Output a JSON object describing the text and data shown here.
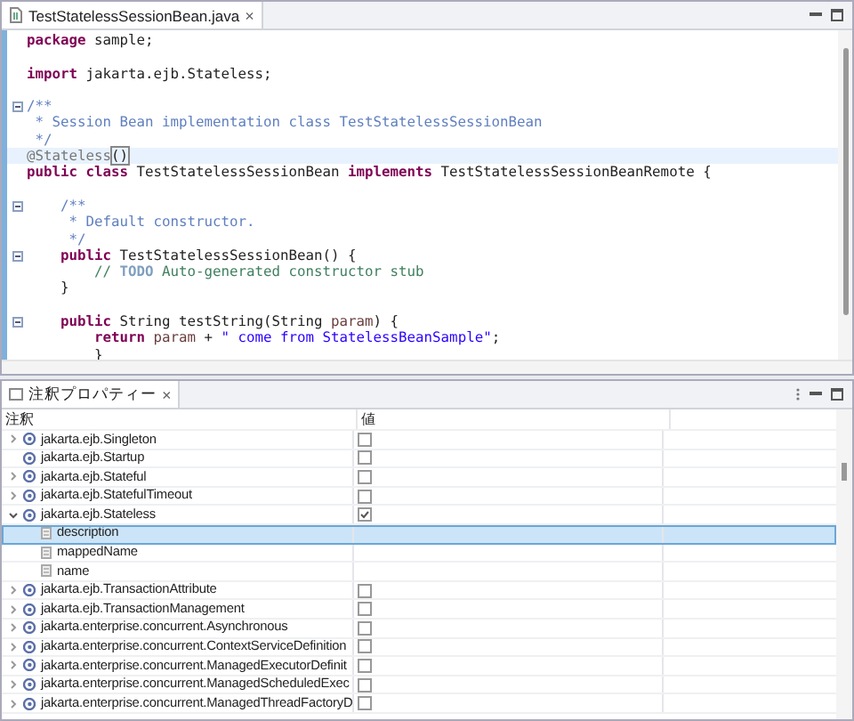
{
  "editor": {
    "tab": {
      "title": "TestStatelessSessionBean.java",
      "close": "×",
      "selected": true
    },
    "lines": [
      {
        "fold": false,
        "current": false,
        "tokens": [
          {
            "kind": "keyword",
            "text": "package"
          },
          {
            "kind": "plain",
            "text": " sample;"
          }
        ]
      },
      {
        "fold": false,
        "current": false
      },
      {
        "fold": false,
        "current": false,
        "tokens": [
          {
            "kind": "keyword",
            "text": "import"
          },
          {
            "kind": "plain",
            "text": " jakarta.ejb.Stateless;"
          }
        ]
      },
      {
        "fold": false,
        "current": false
      },
      {
        "fold": true,
        "current": false,
        "tokens": [
          {
            "kind": "javadoc",
            "text": "/**"
          }
        ]
      },
      {
        "fold": false,
        "current": false,
        "tokens": [
          {
            "kind": "javadoc",
            "text": " * Session Bean implementation class TestStatelessSessionBean"
          }
        ]
      },
      {
        "fold": false,
        "current": false,
        "tokens": [
          {
            "kind": "javadoc",
            "text": " */"
          }
        ]
      },
      {
        "fold": false,
        "current": true,
        "tokens": [
          {
            "kind": "annotation",
            "text": "@Stateless"
          },
          {
            "kind": "bracket",
            "text": "()"
          }
        ]
      },
      {
        "fold": false,
        "current": false,
        "tokens": [
          {
            "kind": "keyword",
            "text": "public class"
          },
          {
            "kind": "plain",
            "text": " TestStatelessSessionBean "
          },
          {
            "kind": "keyword",
            "text": "implements"
          },
          {
            "kind": "plain",
            "text": " TestStatelessSessionBeanRemote {"
          }
        ]
      },
      {
        "fold": false,
        "current": false
      },
      {
        "fold": true,
        "current": false,
        "tokens": [
          {
            "kind": "javadoc",
            "text": "    /**"
          }
        ]
      },
      {
        "fold": false,
        "current": false,
        "tokens": [
          {
            "kind": "javadoc",
            "text": "     * Default constructor."
          }
        ]
      },
      {
        "fold": false,
        "current": false,
        "tokens": [
          {
            "kind": "javadoc",
            "text": "     */"
          }
        ]
      },
      {
        "fold": true,
        "current": false,
        "tokens": [
          {
            "kind": "keyword",
            "text": "    public"
          },
          {
            "kind": "plain",
            "text": " TestStatelessSessionBean() {"
          }
        ]
      },
      {
        "fold": false,
        "current": false,
        "tokens": [
          {
            "kind": "comment",
            "text": "        // "
          },
          {
            "kind": "todo",
            "text": "TODO"
          },
          {
            "kind": "comment",
            "text": " Auto-generated constructor stub"
          }
        ]
      },
      {
        "fold": false,
        "current": false,
        "tokens": [
          {
            "kind": "plain",
            "text": "    }"
          }
        ]
      },
      {
        "fold": false,
        "current": false
      },
      {
        "fold": true,
        "current": false,
        "tokens": [
          {
            "kind": "keyword",
            "text": "    public"
          },
          {
            "kind": "plain",
            "text": " String testString(String "
          },
          {
            "kind": "param",
            "text": "param"
          },
          {
            "kind": "plain",
            "text": ") {"
          }
        ]
      },
      {
        "fold": false,
        "current": false,
        "tokens": [
          {
            "kind": "keyword",
            "text": "        return"
          },
          {
            "kind": "param",
            "text": " param"
          },
          {
            "kind": "plain",
            "text": " + "
          },
          {
            "kind": "string",
            "text": "\" come from StatelessBeanSample\""
          },
          {
            "kind": "plain",
            "text": ";"
          }
        ]
      },
      {
        "fold": false,
        "current": false,
        "tokens": [
          {
            "kind": "plain",
            "text": "        }"
          }
        ]
      }
    ]
  },
  "view": {
    "tab": {
      "title": "注釈プロパティー",
      "close": "×",
      "selected": true
    },
    "columns": [
      "注釈",
      "値"
    ],
    "rows": [
      {
        "kind": "annotation",
        "name": "jakarta.ejb.Singleton",
        "expandable": true,
        "expanded": false,
        "checked": false,
        "selected": false
      },
      {
        "kind": "annotation",
        "name": "jakarta.ejb.Startup",
        "expandable": false,
        "checked": false,
        "selected": false
      },
      {
        "kind": "annotation",
        "name": "jakarta.ejb.Stateful",
        "expandable": true,
        "expanded": false,
        "checked": false,
        "selected": false
      },
      {
        "kind": "annotation",
        "name": "jakarta.ejb.StatefulTimeout",
        "expandable": true,
        "expanded": false,
        "checked": false,
        "selected": false
      },
      {
        "kind": "annotation",
        "name": "jakarta.ejb.Stateless",
        "expandable": true,
        "expanded": true,
        "checked": true,
        "selected": false,
        "children": [
          {
            "kind": "member",
            "name": "description",
            "selected": true
          },
          {
            "kind": "member",
            "name": "mappedName",
            "selected": false
          },
          {
            "kind": "member",
            "name": "name",
            "selected": false
          }
        ]
      },
      {
        "kind": "annotation",
        "name": "jakarta.ejb.TransactionAttribute",
        "expandable": true,
        "expanded": false,
        "checked": false,
        "selected": false
      },
      {
        "kind": "annotation",
        "name": "jakarta.ejb.TransactionManagement",
        "expandable": true,
        "expanded": false,
        "checked": false,
        "selected": false
      },
      {
        "kind": "annotation",
        "name": "jakarta.enterprise.concurrent.Asynchronous",
        "expandable": true,
        "expanded": false,
        "checked": false,
        "selected": false
      },
      {
        "kind": "annotation",
        "name": "jakarta.enterprise.concurrent.ContextServiceDefinition",
        "expandable": true,
        "expanded": false,
        "checked": false,
        "selected": false
      },
      {
        "kind": "annotation",
        "name": "jakarta.enterprise.concurrent.ManagedExecutorDefinit",
        "expandable": true,
        "expanded": false,
        "checked": false,
        "selected": false
      },
      {
        "kind": "annotation",
        "name": "jakarta.enterprise.concurrent.ManagedScheduledExec",
        "expandable": true,
        "expanded": false,
        "checked": false,
        "selected": false
      },
      {
        "kind": "annotation",
        "name": "jakarta.enterprise.concurrent.ManagedThreadFactoryD",
        "expandable": true,
        "expanded": false,
        "checked": false,
        "selected": false
      }
    ]
  }
}
